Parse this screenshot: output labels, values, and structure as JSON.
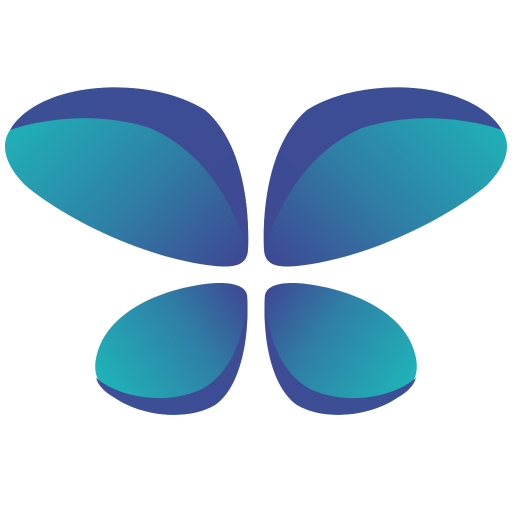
{
  "logo": {
    "icon": "butterfly-logo-icon",
    "colors": {
      "background": "#ffffff",
      "teal": "#1fb3b8",
      "indigo": "#3e4a94",
      "mid": "#2f7fa6"
    }
  }
}
